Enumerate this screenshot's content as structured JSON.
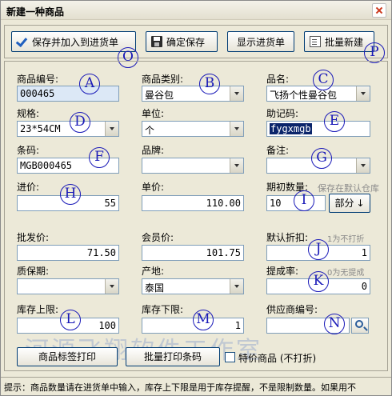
{
  "window": {
    "title": "新建一种商品"
  },
  "toolbar": {
    "save_add_label": "保存并加入到进货单",
    "save_label": "确定保存",
    "show_list_label": "显示进货单",
    "batch_new_label": "批量新建"
  },
  "fields": {
    "code": {
      "label": "商品编号:",
      "value": "000465"
    },
    "category": {
      "label": "商品类别:",
      "value": "曼谷包"
    },
    "name": {
      "label": "品名:",
      "value": "飞扬个性曼谷包"
    },
    "spec": {
      "label": "规格:",
      "value": "23*54CM"
    },
    "unit": {
      "label": "单位:",
      "value": "个"
    },
    "mnemonic": {
      "label": "助记码:",
      "value": "fygxmgb"
    },
    "barcode": {
      "label": "条码:",
      "value": "MGB000465"
    },
    "brand": {
      "label": "品牌:",
      "value": ""
    },
    "remark": {
      "label": "备注:",
      "value": ""
    },
    "purchase_price": {
      "label": "进价:",
      "value": "55"
    },
    "unit_price": {
      "label": "单价:",
      "value": "110.00"
    },
    "initial_qty": {
      "label": "期初数量:",
      "hint": "保存在默认仓库",
      "value": "10",
      "part_button": "部分",
      "part_arrow": "↓"
    },
    "wholesale_price": {
      "label": "批发价:",
      "value": "71.50"
    },
    "member_price": {
      "label": "会员价:",
      "value": "101.75"
    },
    "default_discount": {
      "label": "默认折扣:",
      "hint": "1为不打折",
      "value": "1"
    },
    "shelf_life": {
      "label": "质保期:",
      "value": ""
    },
    "origin": {
      "label": "产地:",
      "value": "泰国"
    },
    "commission_rate": {
      "label": "提成率:",
      "hint": "0为无提成",
      "value": "0"
    },
    "stock_max": {
      "label": "库存上限:",
      "value": "100"
    },
    "stock_min": {
      "label": "库存下限:",
      "value": "1"
    },
    "supplier_code": {
      "label": "供应商编号:",
      "value": ""
    }
  },
  "bottom": {
    "label_print": "商品标签打印",
    "batch_barcode_print": "批量打印条码",
    "special_price_label": "特价商品 (不打折)"
  },
  "markers": {
    "A": "A",
    "B": "B",
    "C": "C",
    "D": "D",
    "E": "E",
    "F": "F",
    "G": "G",
    "H": "H",
    "I": "I",
    "J": "J",
    "K": "K",
    "L": "L",
    "M": "M",
    "N": "N",
    "O": "O",
    "P": "P"
  },
  "watermark": "河源飞翔软件工作室",
  "status": "提示：商品数量请在进货单中输入，库存上下限是用于库存提醒，不是限制数量。如果用不"
}
